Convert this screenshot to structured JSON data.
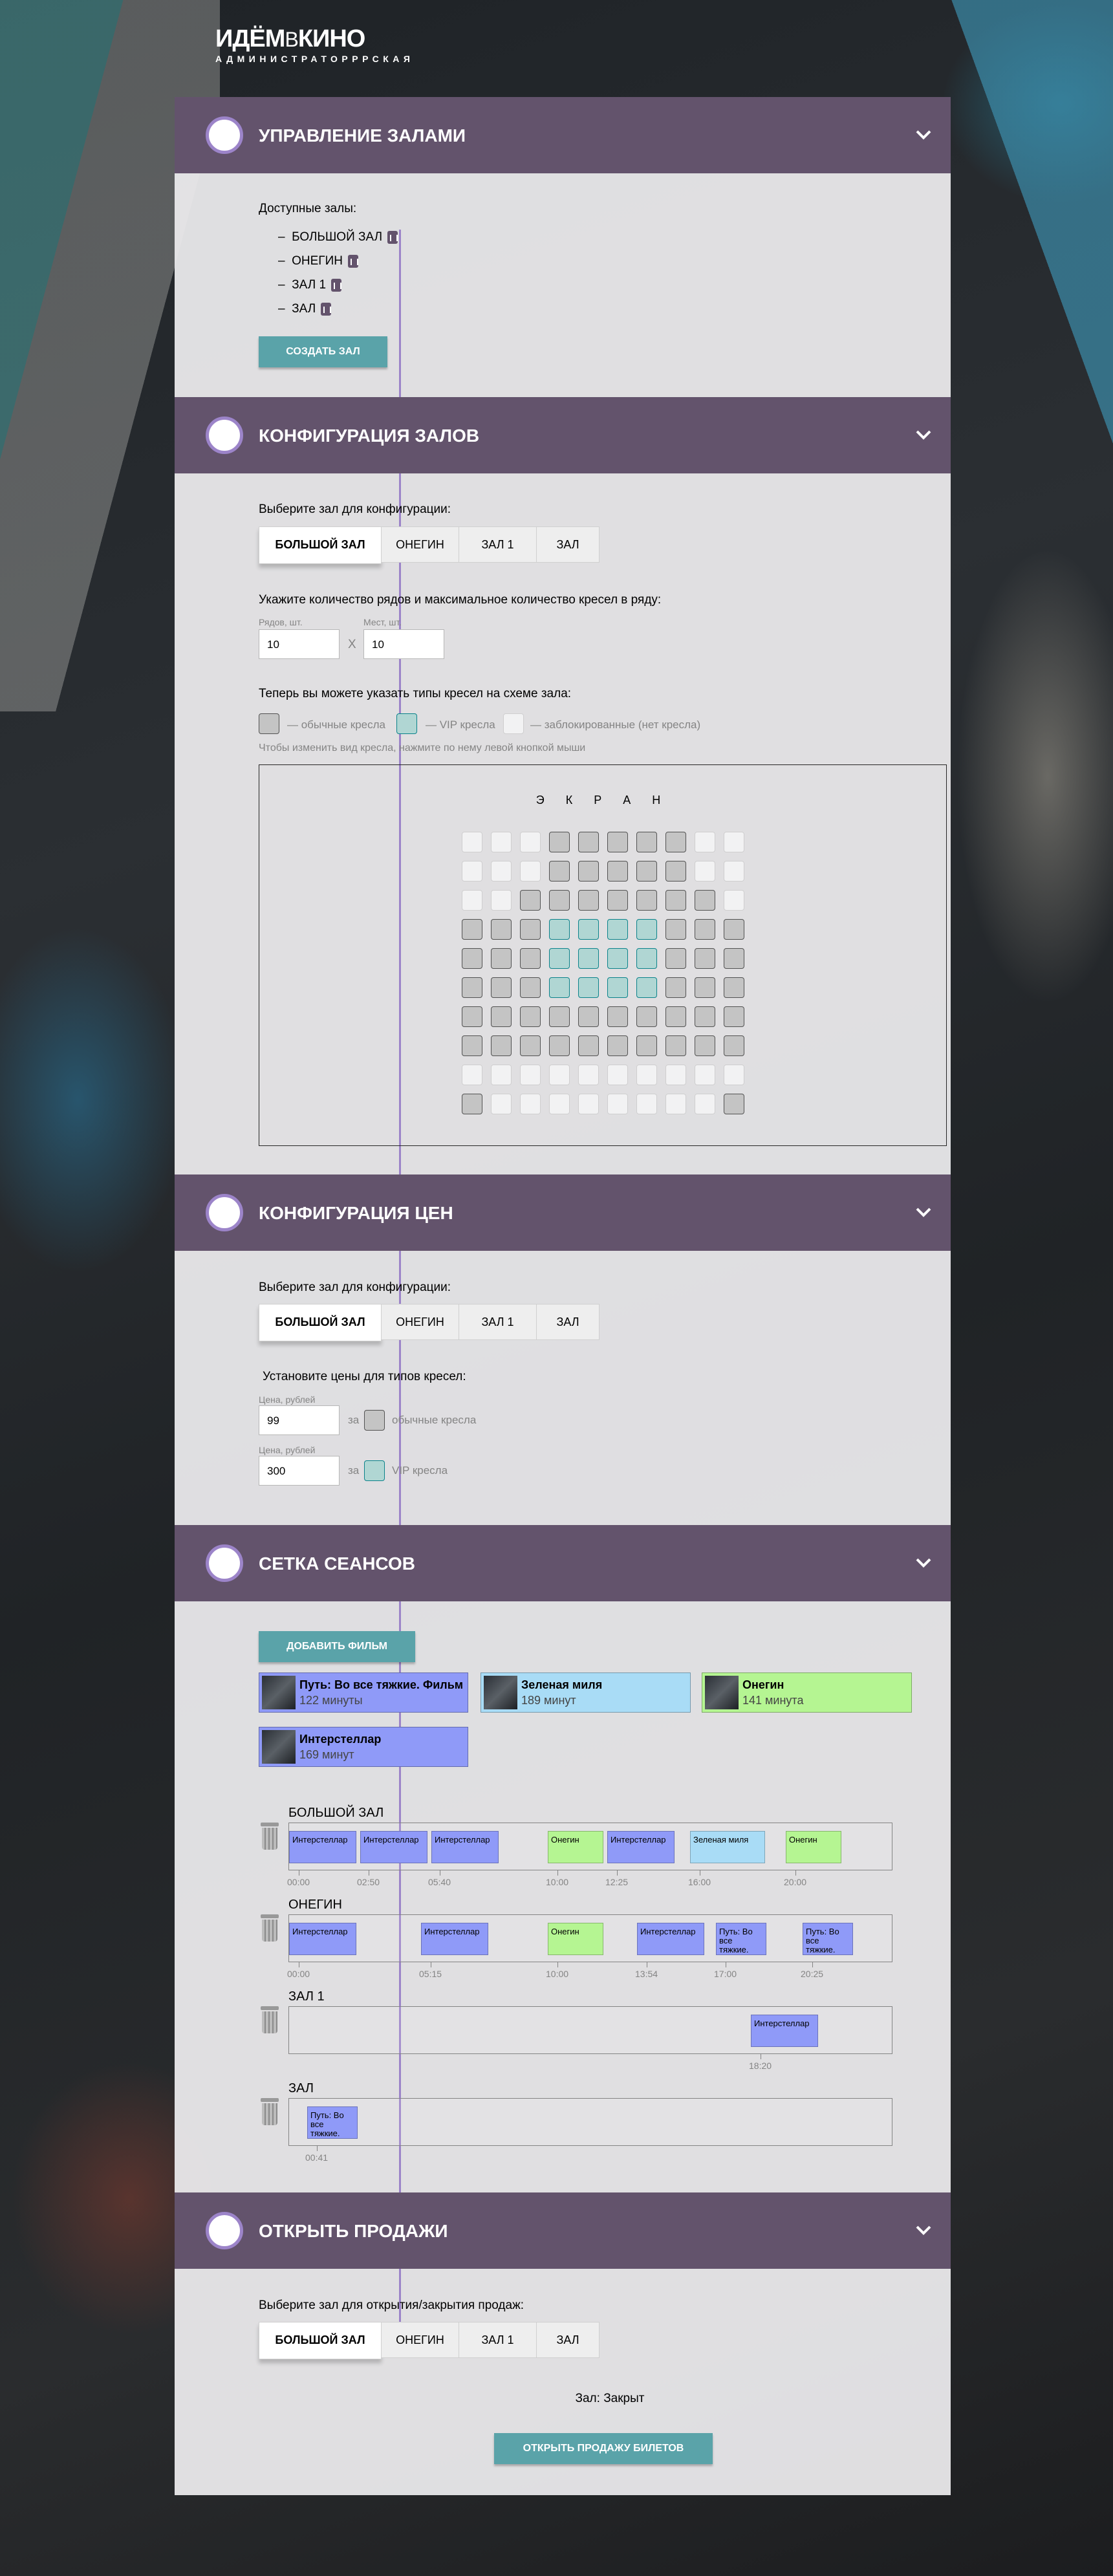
{
  "logo": {
    "part1": "ИДЁМ",
    "part2": "В",
    "part3": "КИНО",
    "subtitle": "АДМИНИСТРАТОРРРСКАЯ"
  },
  "colors": {
    "header": "#63536c",
    "accent": "#9c84c9",
    "button": "#5aa3a9",
    "vip_seat": "#b0d6d3",
    "std_seat": "#c4c4c4"
  },
  "sections": {
    "halls": {
      "title": "Управление залами",
      "available_label": "Доступные залы:",
      "halls": [
        "БОЛЬШОЙ ЗАЛ",
        "ОНЕГИН",
        "ЗАЛ 1",
        "ЗАЛ"
      ],
      "create_button": "Создать зал"
    },
    "config": {
      "title": "Конфигурация залов",
      "select_label": "Выберите зал для конфигурации:",
      "tabs": [
        "Большой зал",
        "Онегин",
        "Зал 1",
        "Зал"
      ],
      "rows_prompt": "Укажите количество рядов и максимальное количество кресел в ряду:",
      "rows_label": "Рядов, шт.",
      "seats_label": "Мест, шт.",
      "rows_value": "10",
      "seats_value": "10",
      "x_sign": "X",
      "types_prompt": "Теперь вы можете указать типы кресел на схеме зала:",
      "legend_std": "— обычные кресла",
      "legend_vip": "— VIP кресла",
      "legend_dis": "— заблокированные (нет кресла)",
      "hint": "Чтобы изменить вид кресла, нажмите по нему левой кнопкой мыши",
      "screen_label": "Э К Р А Н",
      "seat_map": [
        "dddsssssdd",
        "dddsssssdd",
        "ddsssssssd",
        "sssvvvvsss",
        "sssvvvvsss",
        "sssvvvvsss",
        "ssssssssss",
        "ssssssssss",
        "dddddddddd",
        "sddddddddS"
      ]
    },
    "prices": {
      "title": "Конфигурация цен",
      "select_label": "Выберите зал для конфигурации:",
      "tabs": [
        "Большой зал",
        "Онегин",
        "Зал 1",
        "Зал"
      ],
      "set_prompt": "Установите цены для типов кресел:",
      "price_label": "Цена, рублей",
      "std_price": "99",
      "vip_price": "300",
      "for_word": "за",
      "std_caption": "обычные кресла",
      "vip_caption": "VIP кресла"
    },
    "schedule": {
      "title": "Сетка сеансов",
      "add_button": "Добавить фильм",
      "movies": [
        {
          "title": "Путь: Во все тяжкие. Фильм",
          "duration": "122 минуты",
          "color": "#8f9af8"
        },
        {
          "title": "Зеленая миля",
          "duration": "189 минут",
          "color": "#a9dcf6"
        },
        {
          "title": "Онегин",
          "duration": "141 минута",
          "color": "#b5f592"
        },
        {
          "title": "Интерстеллар",
          "duration": "169 минут",
          "color": "#8f9af8"
        }
      ],
      "halls": [
        {
          "name": "БОЛЬШОЙ ЗАЛ",
          "sessions": [
            {
              "label": "Интерстеллар",
              "color": "#8f9af8",
              "start": 0,
              "len": 104
            },
            {
              "label": "Интерстеллар",
              "color": "#8f9af8",
              "start": 110,
              "len": 104
            },
            {
              "label": "Интерстеллар",
              "color": "#8f9af8",
              "start": 220,
              "len": 104
            },
            {
              "label": "Онегин",
              "color": "#b5f592",
              "start": 400,
              "len": 86
            },
            {
              "label": "Интерстеллар",
              "color": "#8f9af8",
              "start": 492,
              "len": 104
            },
            {
              "label": "Зеленая миля",
              "color": "#a9dcf6",
              "start": 620,
              "len": 116
            },
            {
              "label": "Онегин",
              "color": "#b5f592",
              "start": 768,
              "len": 86
            }
          ],
          "ticks": [
            "00:00",
            "02:50",
            "05:40",
            "10:00",
            "12:25",
            "16:00",
            "20:00"
          ]
        },
        {
          "name": "ОНЕГИН",
          "sessions": [
            {
              "label": "Интерстеллар",
              "color": "#8f9af8",
              "start": 0,
              "len": 104
            },
            {
              "label": "Интерстеллар",
              "color": "#8f9af8",
              "start": 204,
              "len": 104
            },
            {
              "label": "Онегин",
              "color": "#b5f592",
              "start": 400,
              "len": 86
            },
            {
              "label": "Интерстеллар",
              "color": "#8f9af8",
              "start": 538,
              "len": 104
            },
            {
              "label": "Путь: Во все тяжкие.",
              "color": "#8f9af8",
              "start": 660,
              "len": 78
            },
            {
              "label": "Путь: Во все тяжкие.",
              "color": "#8f9af8",
              "start": 794,
              "len": 78
            }
          ],
          "ticks": [
            "00:00",
            "05:15",
            "10:00",
            "13:54",
            "17:00",
            "20:25"
          ]
        },
        {
          "name": "ЗАЛ 1",
          "sessions": [
            {
              "label": "Интерстеллар",
              "color": "#8f9af8",
              "start": 714,
              "len": 104
            }
          ],
          "ticks": [
            "18:20"
          ]
        },
        {
          "name": "ЗАЛ",
          "sessions": [
            {
              "label": "Путь: Во все тяжкие.",
              "color": "#8f9af8",
              "start": 28,
              "len": 78
            }
          ],
          "ticks": [
            "00:41"
          ]
        }
      ]
    },
    "sales": {
      "title": "Открыть продажи",
      "select_label": "Выберите зал для открытия/закрытия продаж:",
      "tabs": [
        "Большой зал",
        "Онегин",
        "Зал 1",
        "Зал"
      ],
      "status": "Зал: Закрыт",
      "open_button": "Открыть продажу билетов"
    }
  }
}
